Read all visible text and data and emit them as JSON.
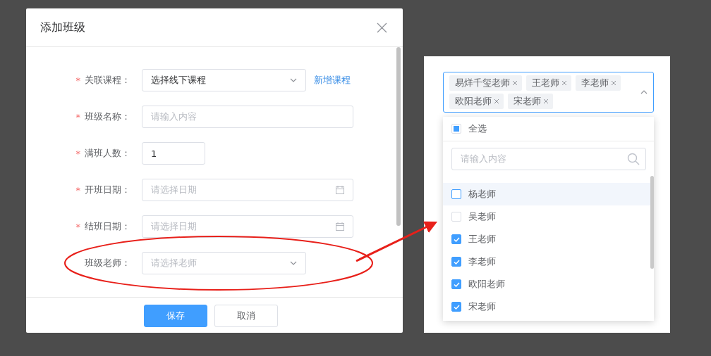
{
  "dialog": {
    "title": "添加班级",
    "fields": [
      {
        "label": "关联课程：",
        "required_mark": "*",
        "kind": "select",
        "value": "选择线下课程",
        "link": "新增课程",
        "highlighted": false
      },
      {
        "label": "班级名称：",
        "required_mark": "*",
        "kind": "text",
        "placeholder": "请输入内容",
        "highlighted": false
      },
      {
        "label": "满班人数：",
        "required_mark": "*",
        "kind": "number",
        "value": "1",
        "highlighted": false
      },
      {
        "label": "开班日期：",
        "required_mark": "*",
        "kind": "date",
        "placeholder": "请选择日期",
        "highlighted": false
      },
      {
        "label": "结班日期：",
        "required_mark": "*",
        "kind": "date",
        "placeholder": "请选择日期",
        "highlighted": false
      },
      {
        "label": "班级老师：",
        "kind": "select",
        "placeholder": "请选择老师",
        "highlighted": true
      }
    ],
    "buttons": [
      {
        "label": "保存",
        "primary": true
      },
      {
        "label": "取消",
        "primary": false
      }
    ]
  },
  "teacher_picker": {
    "expanded": true,
    "tags": [
      "易烊千玺老师",
      "王老师",
      "李老师",
      "欧阳老师",
      "宋老师"
    ],
    "select_all": {
      "label": "全选",
      "indeterminate": true
    },
    "search": {
      "placeholder": "请输入内容"
    },
    "options": [
      {
        "label": "杨老师",
        "checked": false,
        "hovered": true
      },
      {
        "label": "吴老师",
        "checked": false,
        "hovered": false
      },
      {
        "label": "王老师",
        "checked": true,
        "hovered": false
      },
      {
        "label": "李老师",
        "checked": true,
        "hovered": false
      },
      {
        "label": "欧阳老师",
        "checked": true,
        "hovered": false
      },
      {
        "label": "宋老师",
        "checked": true,
        "hovered": false
      }
    ]
  }
}
